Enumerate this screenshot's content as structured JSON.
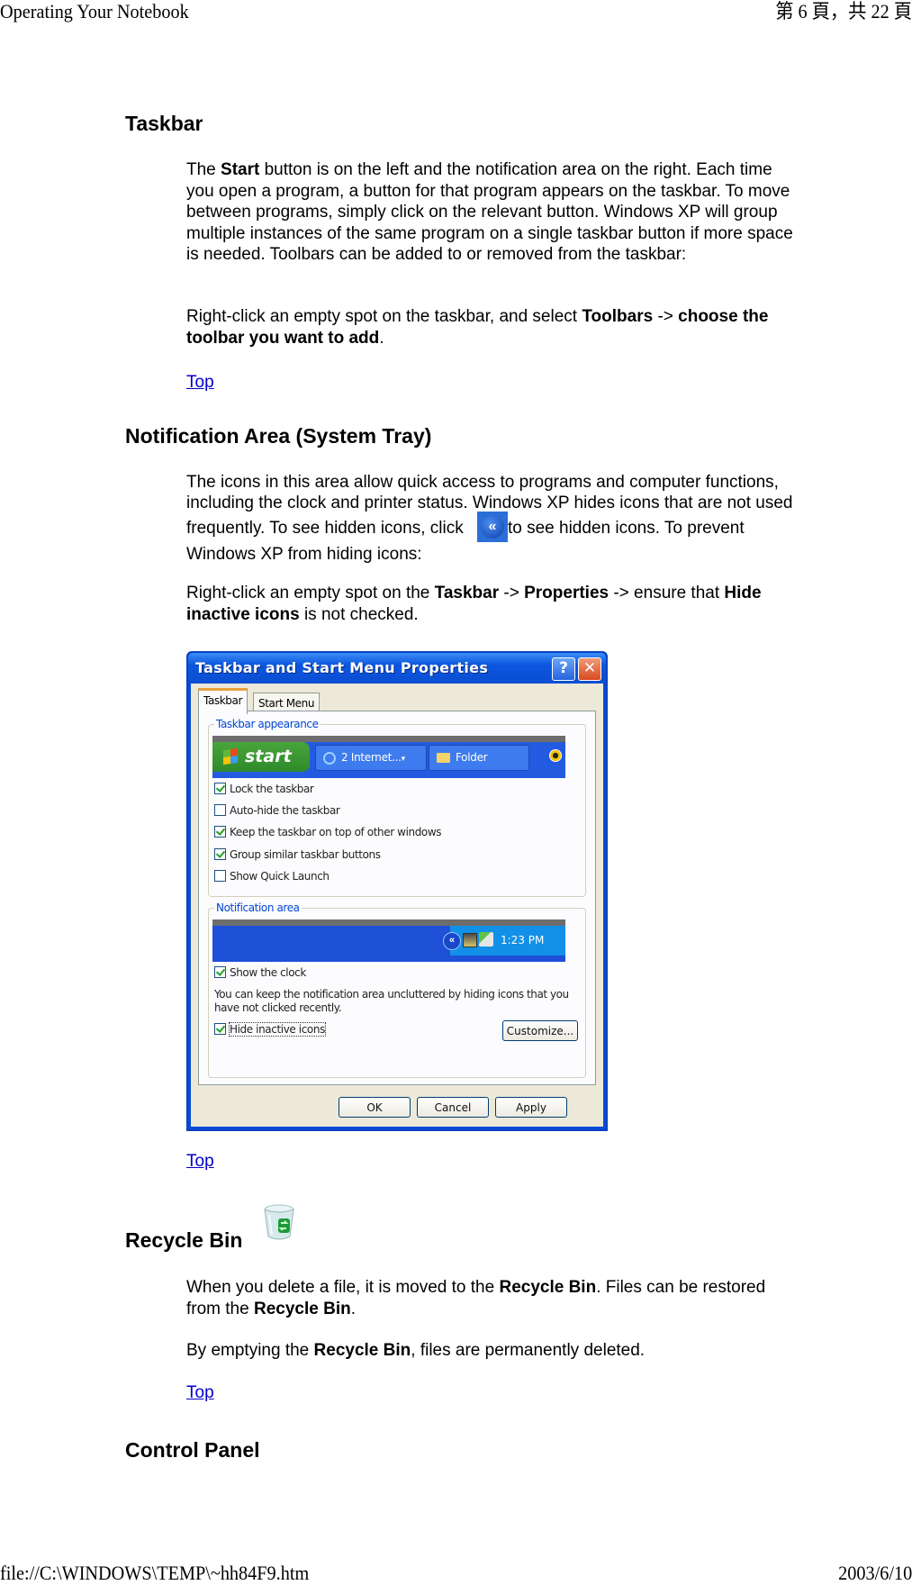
{
  "header": {
    "title": "Operating Your Notebook",
    "page_indicator": "第 6 頁，共 22 頁"
  },
  "footer": {
    "file_path": "file://C:\\WINDOWS\\TEMP\\~hh84F9.htm",
    "date": "2003/6/10"
  },
  "sections": {
    "taskbar": {
      "heading": "Taskbar",
      "p1_parts": [
        "The ",
        "Start",
        " button is on the left and the notification area on the right. Each time you open a program, a button for that program appears on the taskbar. To move between programs, simply click on the relevant button. Windows XP will group multiple instances of the same program on a single taskbar button if more space is needed. Toolbars can be added to or removed from the taskbar:"
      ],
      "p2_parts": [
        "Right-click an empty spot on the taskbar, and select ",
        "Toolbars",
        " -> ",
        "choose the toolbar you want to add",
        "."
      ],
      "top_link": "Top"
    },
    "notification": {
      "heading": "Notification Area (System Tray)",
      "p1_parts": [
        "The icons in this area allow quick access to programs and computer functions, including the clock and printer status. Windows XP hides icons that are not used frequently. To see hidden icons, click ",
        "to see hidden icons. To prevent Windows XP from hiding icons:"
      ],
      "inline_icon": "show-hidden-icons-chevron",
      "p2_parts": [
        "Right-click an empty spot on the ",
        "Taskbar",
        " -> ",
        "Properties",
        " -> ensure that ",
        "Hide inactive icons",
        " is not checked."
      ],
      "top_link": "Top"
    },
    "recycle": {
      "heading": "Recycle Bin",
      "icon": "recycle-bin",
      "p1_parts": [
        "When you delete a file, it is moved to the ",
        "Recycle Bin",
        ". Files can be restored from the ",
        "Recycle Bin",
        "."
      ],
      "p2_parts": [
        "By emptying the ",
        "Recycle Bin",
        ", files are permanently deleted."
      ],
      "top_link": "Top"
    },
    "control_panel": {
      "heading": "Control Panel"
    }
  },
  "dialog": {
    "title": "Taskbar and Start Menu Properties",
    "help_label": "?",
    "close_label": "✕",
    "tabs": [
      {
        "label": "Taskbar",
        "active": true
      },
      {
        "label": "Start Menu",
        "active": false
      }
    ],
    "taskbar_group": {
      "label": "Taskbar appearance",
      "preview": {
        "start_label": "start",
        "items": [
          "2 Internet...",
          "Folder"
        ],
        "dropdown_glyph": "▾"
      },
      "options": [
        {
          "label": "Lock the taskbar",
          "checked": true
        },
        {
          "label": "Auto-hide the taskbar",
          "checked": false
        },
        {
          "label": "Keep the taskbar on top of other windows",
          "checked": true
        },
        {
          "label": "Group similar taskbar buttons",
          "checked": true
        },
        {
          "label": "Show Quick Launch",
          "checked": false
        }
      ]
    },
    "notification_group": {
      "label": "Notification area",
      "preview": {
        "chevron": "«",
        "clock": "1:23 PM"
      },
      "show_clock": {
        "label": "Show the clock",
        "checked": true
      },
      "description": "You can keep the notification area uncluttered by hiding icons that you have not clicked recently.",
      "hide_inactive": {
        "label": "Hide inactive icons",
        "checked": true
      },
      "customize_label": "Customize..."
    },
    "buttons": {
      "ok": "OK",
      "cancel": "Cancel",
      "apply": "Apply"
    }
  }
}
